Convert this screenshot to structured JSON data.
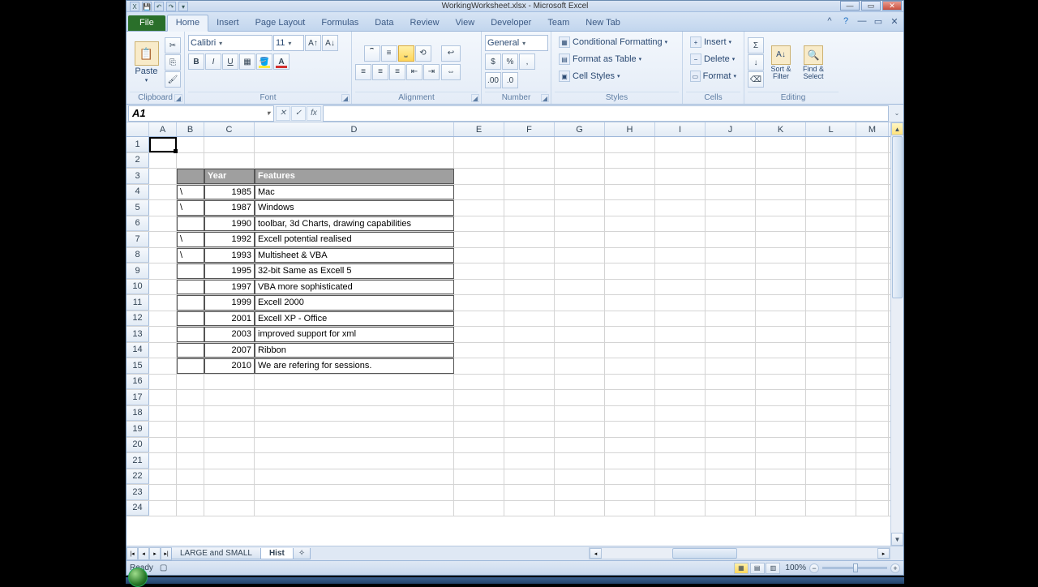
{
  "titlebar": {
    "title": "WorkingWorksheet.xlsx - Microsoft Excel"
  },
  "tabs": {
    "file": "File",
    "home": "Home",
    "insert": "Insert",
    "pagelayout": "Page Layout",
    "formulas": "Formulas",
    "data": "Data",
    "review": "Review",
    "view": "View",
    "developer": "Developer",
    "team": "Team",
    "newtab": "New Tab"
  },
  "ribbon": {
    "clipboard": {
      "label": "Clipboard",
      "paste": "Paste"
    },
    "font": {
      "label": "Font",
      "name": "Calibri",
      "size": "11"
    },
    "alignment": {
      "label": "Alignment"
    },
    "number": {
      "label": "Number",
      "format": "General"
    },
    "styles": {
      "label": "Styles",
      "cond": "Conditional Formatting",
      "table": "Format as Table",
      "cell": "Cell Styles"
    },
    "cells": {
      "label": "Cells",
      "insert": "Insert",
      "delete": "Delete",
      "format": "Format"
    },
    "editing": {
      "label": "Editing",
      "sort": "Sort & Filter",
      "find": "Find & Select"
    }
  },
  "namebox": "A1",
  "columns": [
    "A",
    "B",
    "C",
    "D",
    "E",
    "F",
    "G",
    "H",
    "I",
    "J",
    "K",
    "L",
    "M"
  ],
  "table": {
    "headers": {
      "c": "Year",
      "d": "Features"
    },
    "rows": [
      {
        "b": "\\",
        "c": "1985",
        "d": "Mac"
      },
      {
        "b": "\\",
        "c": "1987",
        "d": "Windows"
      },
      {
        "b": "",
        "c": "1990",
        "d": "toolbar, 3d Charts, drawing capabilities"
      },
      {
        "b": "\\",
        "c": "1992",
        "d": "Excell potential realised"
      },
      {
        "b": "\\",
        "c": "1993",
        "d": "Multisheet & VBA"
      },
      {
        "b": "",
        "c": "1995",
        "d": "32-bit Same as Excell 5"
      },
      {
        "b": "",
        "c": "1997",
        "d": "VBA more sophisticated"
      },
      {
        "b": "",
        "c": "1999",
        "d": "Excell 2000"
      },
      {
        "b": "",
        "c": "2001",
        "d": "Excell XP - Office"
      },
      {
        "b": "",
        "c": "2003",
        "d": "improved support for xml"
      },
      {
        "b": "",
        "c": "2007",
        "d": "Ribbon"
      },
      {
        "b": "",
        "c": "2010",
        "d": "We are refering for sessions."
      }
    ]
  },
  "sheets": {
    "s1": "LARGE and SMALL",
    "s2": "Hist"
  },
  "status": {
    "ready": "Ready",
    "zoom": "100%"
  }
}
